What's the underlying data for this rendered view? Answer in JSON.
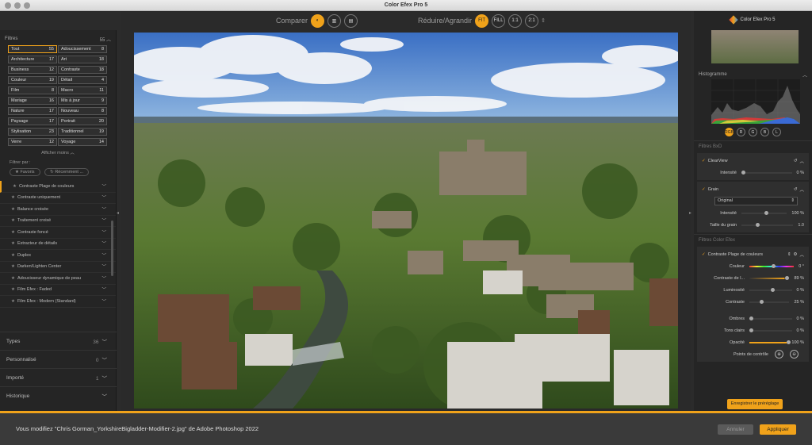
{
  "window": {
    "title": "Color Efex Pro 5"
  },
  "toolbar": {
    "compare_label": "Comparer",
    "resize_label": "Réduire/Agrandir",
    "zoom_options": [
      "FIT",
      "FILL",
      "1:1",
      "2:1"
    ]
  },
  "left": {
    "filters_header": "Filtres",
    "filters_count": "55",
    "categories": [
      {
        "name": "Tout",
        "count": "55"
      },
      {
        "name": "Adoucissement",
        "count": "8"
      },
      {
        "name": "Architecture",
        "count": "17"
      },
      {
        "name": "Art",
        "count": "18"
      },
      {
        "name": "Business",
        "count": "12"
      },
      {
        "name": "Contraste",
        "count": "18"
      },
      {
        "name": "Couleur",
        "count": "19"
      },
      {
        "name": "Détail",
        "count": "4"
      },
      {
        "name": "Film",
        "count": "8"
      },
      {
        "name": "Macro",
        "count": "11"
      },
      {
        "name": "Mariage",
        "count": "16"
      },
      {
        "name": "Mis à jour",
        "count": "9"
      },
      {
        "name": "Nature",
        "count": "17"
      },
      {
        "name": "Nouveau",
        "count": "8"
      },
      {
        "name": "Paysage",
        "count": "17"
      },
      {
        "name": "Portrait",
        "count": "20"
      },
      {
        "name": "Stylisation",
        "count": "23"
      },
      {
        "name": "Traditionnel",
        "count": "19"
      },
      {
        "name": "Verre",
        "count": "12"
      },
      {
        "name": "Voyage",
        "count": "14"
      }
    ],
    "show_less": "Afficher moins",
    "filter_by": "Filtrer par :",
    "favorites": "Favoris",
    "recent": "Récemment ...",
    "filter_list": [
      "Contraste Plage de couleurs",
      "Contraste uniquement",
      "Balance croisée",
      "Traitement croisé",
      "Contraste foncé",
      "Extracteur de détails",
      "Duplex",
      "Darken/Lighten Center",
      "Adoucisseur dynamique de peau",
      "Film Efex : Faded",
      "Film Efex : Modern (Standard)"
    ],
    "sections": [
      {
        "name": "Types",
        "count": "36"
      },
      {
        "name": "Personnalisé",
        "count": "0"
      },
      {
        "name": "Importé",
        "count": "1"
      },
      {
        "name": "Historique",
        "count": ""
      }
    ]
  },
  "right": {
    "brand": "Color Efex Pro 5",
    "histogram_label": "Histogramme",
    "histogram_channels": [
      "RGB",
      "R",
      "G",
      "B",
      "L"
    ],
    "filter_bw_label": "Filtres BxD",
    "clearview": {
      "name": "ClearView",
      "intensity_label": "Intensité",
      "intensity_value": "0 %"
    },
    "grain": {
      "name": "Grain",
      "preset": "Original",
      "intensity_label": "Intensité",
      "intensity_value": "100 %",
      "size_label": "Taille du grain",
      "size_value": "1.0"
    },
    "color_filters_label": "Filtres Color Efex",
    "ccr": {
      "name": "Contraste Plage de couleurs",
      "rows": [
        {
          "label": "Couleur",
          "value": "0 °"
        },
        {
          "label": "Contraste de l...",
          "value": "89 %"
        },
        {
          "label": "Luminosité",
          "value": "0 %"
        },
        {
          "label": "Contraste",
          "value": "25 %"
        },
        {
          "label": "Ombres",
          "value": "0 %"
        },
        {
          "label": "Tons clairs",
          "value": "0 %"
        },
        {
          "label": "Opacité",
          "value": "100 %"
        }
      ],
      "control_points_label": "Points de contrôle"
    },
    "save_preset": "Enregistrer le préréglage"
  },
  "status": {
    "message": "Vous modifiez \"Chris Gorman_YorkshireBigladder-Modifier-2.jpg\" de Adobe Photoshop 2022",
    "cancel": "Annuler",
    "apply": "Appliquer"
  },
  "colors": {
    "accent": "#f0a21a"
  }
}
